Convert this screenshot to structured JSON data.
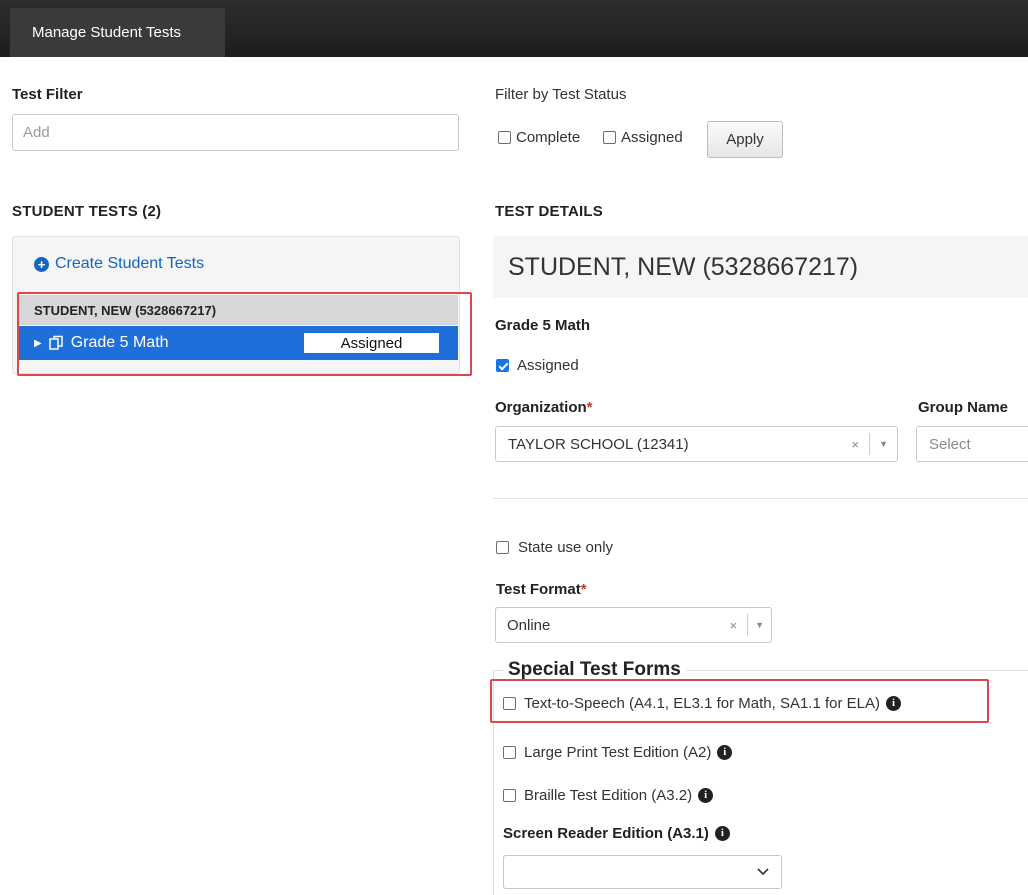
{
  "topbar": {
    "tab_label": "Manage Student Tests"
  },
  "filter": {
    "test_filter_label": "Test Filter",
    "test_filter_placeholder": "Add",
    "status_label": "Filter by Test Status",
    "complete_label": "Complete",
    "assigned_label": "Assigned",
    "apply_label": "Apply"
  },
  "student_tests": {
    "heading": "STUDENT TESTS (2)",
    "create_link": "Create Student Tests",
    "student_name": "STUDENT, NEW (5328667217)",
    "test_name": "Grade 5 Math",
    "test_status": "Assigned"
  },
  "details": {
    "heading": "TEST DETAILS",
    "student_title": "STUDENT, NEW (5328667217)",
    "test_name": "Grade 5 Math",
    "assigned_label": "Assigned",
    "assigned_checked": true,
    "organization_label": "Organization",
    "organization_value": "TAYLOR SCHOOL (12341)",
    "group_name_label": "Group Name",
    "group_name_placeholder": "Select",
    "state_use_label": "State use only",
    "test_format_label": "Test Format",
    "test_format_value": "Online",
    "required_mark": "*",
    "special_forms_legend": "Special Test Forms",
    "tts_label": "Text-to-Speech (A4.1, EL3.1 for Math, SA1.1 for ELA)",
    "large_print_label": "Large Print Test Edition (A2)",
    "braille_label": "Braille Test Edition (A3.2)",
    "screen_reader_label": "Screen Reader Edition (A3.1)",
    "info_glyph": "i",
    "clear_glyph": "×"
  },
  "colors": {
    "selected_row": "#1e6fd9",
    "highlight_box": "#e0474c",
    "link": "#1565c0"
  }
}
